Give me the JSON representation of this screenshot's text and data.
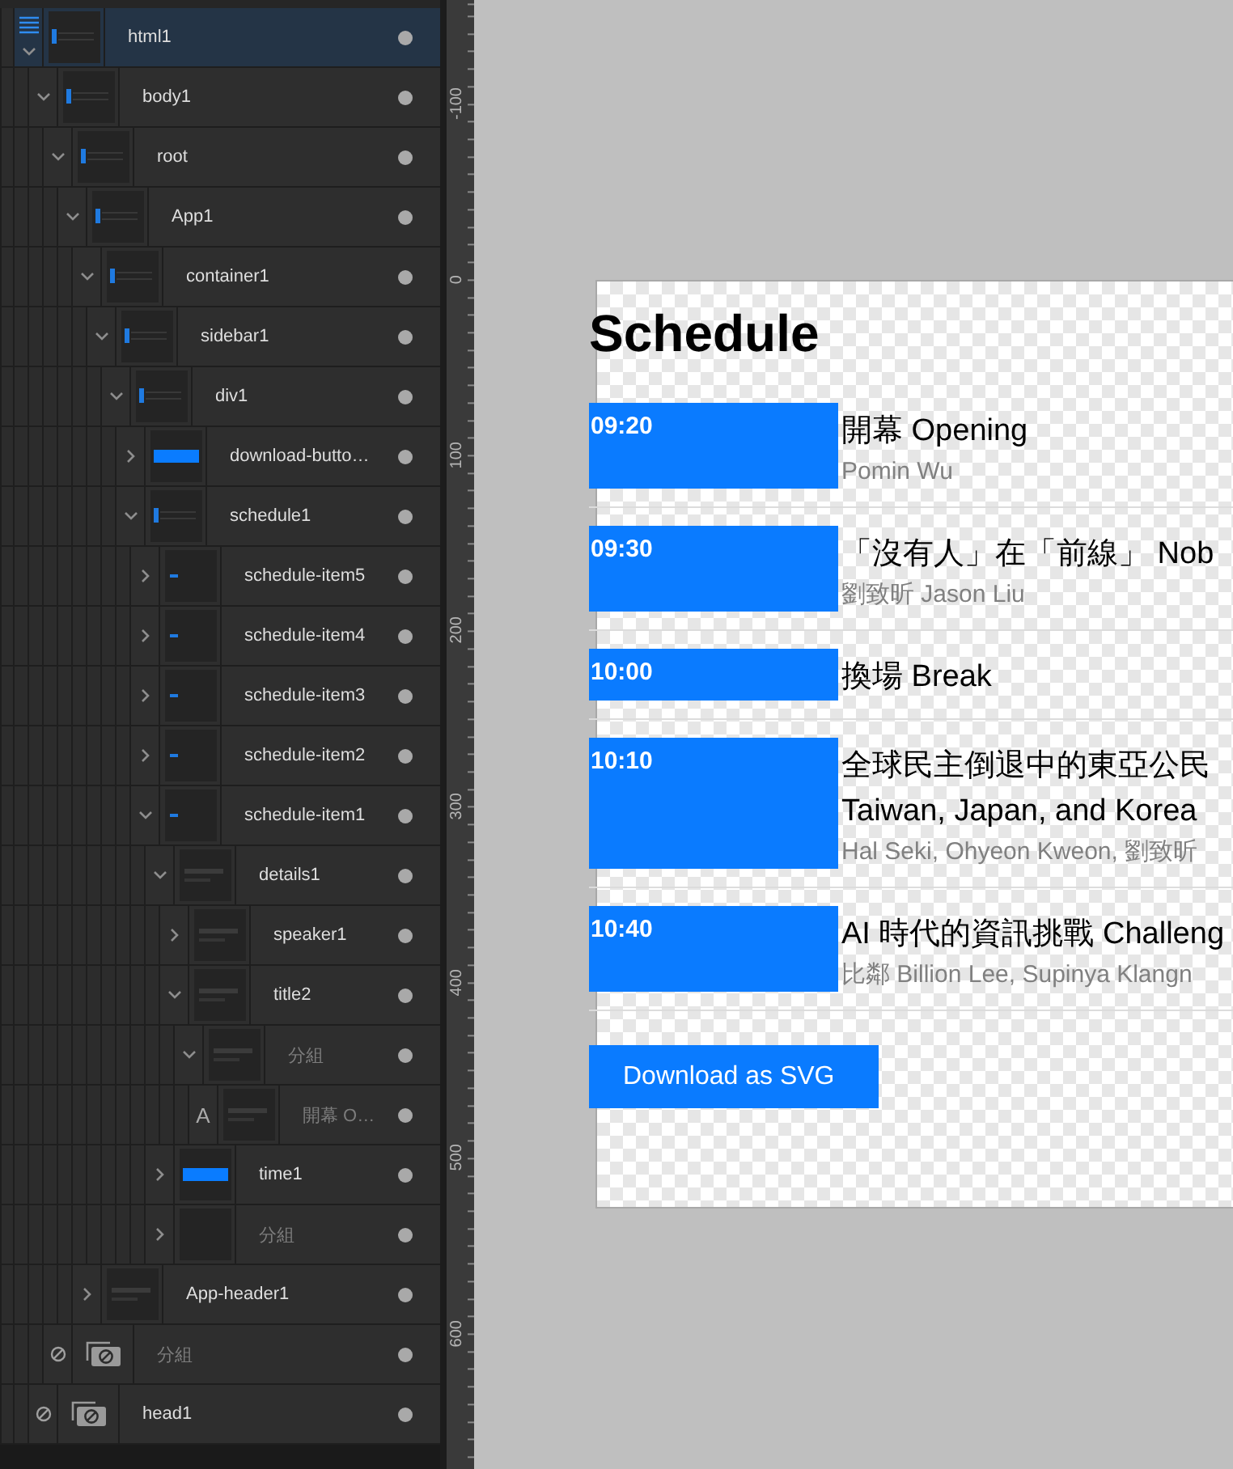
{
  "layers": [
    {
      "name": "html1",
      "kind": "frame",
      "thumbnail": {
        "kind": "bar"
      },
      "selected": true,
      "dimmed": false,
      "expanded": true,
      "children": [
        {
          "name": "body1",
          "kind": "frame",
          "thumbnail": {
            "kind": "bar"
          },
          "selected": false,
          "dimmed": false,
          "expanded": true,
          "children": [
            {
              "name": "root",
              "kind": "frame",
              "thumbnail": {
                "kind": "bar"
              },
              "selected": false,
              "dimmed": false,
              "expanded": true,
              "children": [
                {
                  "name": "App1",
                  "kind": "frame",
                  "thumbnail": {
                    "kind": "bar"
                  },
                  "selected": false,
                  "dimmed": false,
                  "expanded": true,
                  "children": [
                    {
                      "name": "container1",
                      "kind": "frame",
                      "thumbnail": {
                        "kind": "bar"
                      },
                      "selected": false,
                      "dimmed": false,
                      "expanded": true,
                      "children": [
                        {
                          "name": "sidebar1",
                          "kind": "frame",
                          "thumbnail": {
                            "kind": "bar"
                          },
                          "selected": false,
                          "dimmed": false,
                          "expanded": true,
                          "children": [
                            {
                              "name": "div1",
                              "kind": "frame",
                              "thumbnail": {
                                "kind": "bar"
                              },
                              "selected": false,
                              "dimmed": false,
                              "expanded": true,
                              "children": [
                                {
                                  "name": "download-butto…",
                                  "kind": "frame",
                                  "thumbnail": {
                                    "kind": "button"
                                  },
                                  "selected": false,
                                  "dimmed": false,
                                  "expanded": false
                                },
                                {
                                  "name": "schedule1",
                                  "kind": "frame",
                                  "thumbnail": {
                                    "kind": "bar"
                                  },
                                  "selected": false,
                                  "dimmed": false,
                                  "expanded": true,
                                  "children": [
                                    {
                                      "name": "schedule-item5",
                                      "kind": "frame",
                                      "thumbnail": {
                                        "kind": "dash"
                                      },
                                      "selected": false,
                                      "dimmed": false,
                                      "expanded": false
                                    },
                                    {
                                      "name": "schedule-item4",
                                      "kind": "frame",
                                      "thumbnail": {
                                        "kind": "dash"
                                      },
                                      "selected": false,
                                      "dimmed": false,
                                      "expanded": false
                                    },
                                    {
                                      "name": "schedule-item3",
                                      "kind": "frame",
                                      "thumbnail": {
                                        "kind": "dash"
                                      },
                                      "selected": false,
                                      "dimmed": false,
                                      "expanded": false
                                    },
                                    {
                                      "name": "schedule-item2",
                                      "kind": "frame",
                                      "thumbnail": {
                                        "kind": "dash"
                                      },
                                      "selected": false,
                                      "dimmed": false,
                                      "expanded": false
                                    },
                                    {
                                      "name": "schedule-item1",
                                      "kind": "frame",
                                      "thumbnail": {
                                        "kind": "dash"
                                      },
                                      "selected": false,
                                      "dimmed": false,
                                      "expanded": true,
                                      "children": [
                                        {
                                          "name": "details1",
                                          "kind": "frame",
                                          "thumbnail": {
                                            "kind": "lines"
                                          },
                                          "selected": false,
                                          "dimmed": false,
                                          "expanded": true,
                                          "children": [
                                            {
                                              "name": "speaker1",
                                              "kind": "frame",
                                              "thumbnail": {
                                                "kind": "lines"
                                              },
                                              "selected": false,
                                              "dimmed": false,
                                              "expanded": false
                                            },
                                            {
                                              "name": "title2",
                                              "kind": "frame",
                                              "thumbnail": {
                                                "kind": "lines"
                                              },
                                              "selected": false,
                                              "dimmed": false,
                                              "expanded": true,
                                              "children": [
                                                {
                                                  "name": "分組",
                                                  "kind": "frame",
                                                  "thumbnail": {
                                                    "kind": "lines"
                                                  },
                                                  "selected": false,
                                                  "dimmed": true,
                                                  "expanded": true,
                                                  "children": [
                                                    {
                                                      "name": "開幕 O…",
                                                      "kind": "text",
                                                      "glyph": "A",
                                                      "thumbnail": {
                                                        "kind": "lines"
                                                      },
                                                      "selected": false,
                                                      "dimmed": true
                                                    }
                                                  ]
                                                }
                                              ]
                                            }
                                          ]
                                        },
                                        {
                                          "name": "time1",
                                          "kind": "frame",
                                          "thumbnail": {
                                            "kind": "button"
                                          },
                                          "selected": false,
                                          "dimmed": false,
                                          "expanded": false
                                        },
                                        {
                                          "name": "分組",
                                          "kind": "frame",
                                          "thumbnail": {
                                            "kind": "blank"
                                          },
                                          "selected": false,
                                          "dimmed": true,
                                          "expanded": false
                                        }
                                      ]
                                    }
                                  ]
                                }
                              ]
                            }
                          ]
                        }
                      ]
                    },
                    {
                      "name": "App-header1",
                      "kind": "frame",
                      "thumbnail": {
                        "kind": "lines"
                      },
                      "selected": false,
                      "dimmed": false,
                      "expanded": false
                    }
                  ]
                }
              ]
            },
            {
              "name": "分組",
              "kind": "hidden",
              "selected": false,
              "dimmed": true
            }
          ]
        },
        {
          "name": "head1",
          "kind": "hidden",
          "selected": false,
          "dimmed": false
        }
      ]
    }
  ],
  "ruler": {
    "labels": [
      "-100",
      "0",
      "100",
      "200",
      "300",
      "400",
      "500",
      "600"
    ]
  },
  "artboard": {
    "heading": "Schedule",
    "items": [
      {
        "time": "09:20",
        "title_lines": [
          "開幕 Opening"
        ],
        "speaker": "Pomin Wu"
      },
      {
        "time": "09:30",
        "title_lines": [
          "「沒有人」在「前線」 Nob"
        ],
        "speaker": "劉致昕 Jason Liu"
      },
      {
        "time": "10:00",
        "title_lines": [
          "換場 Break"
        ]
      },
      {
        "time": "10:10",
        "title_lines": [
          "全球民主倒退中的東亞公民",
          "Taiwan, Japan, and Korea"
        ],
        "speaker": "Hal Seki, Ohyeon Kweon, 劉致昕"
      },
      {
        "time": "10:40",
        "title_lines": [
          "AI 時代的資訊挑戰 Challeng"
        ],
        "speaker": "比鄰 Billion Lee, Supinya Klangn"
      }
    ],
    "button": "Download as SVG"
  }
}
